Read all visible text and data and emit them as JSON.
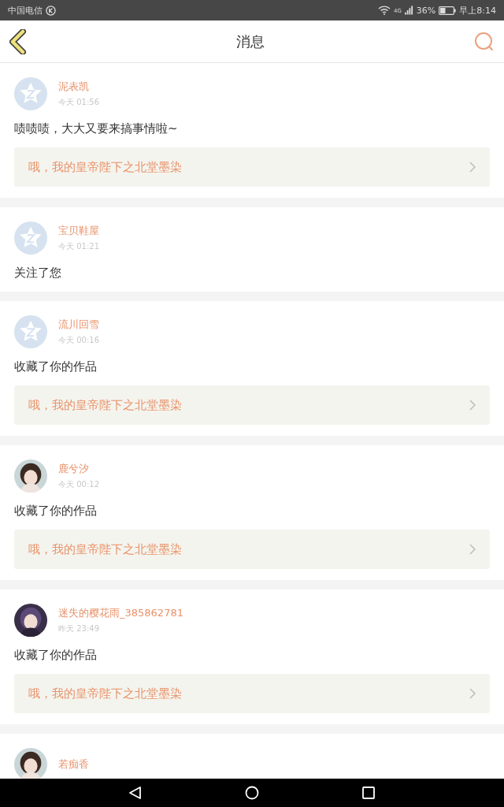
{
  "status_bar": {
    "carrier": "中国电信",
    "network": "4G",
    "battery": "36%",
    "time": "早上8:14"
  },
  "header": {
    "title": "消息"
  },
  "messages": [
    {
      "kind": "default",
      "name": "泥表凯",
      "time": "今天 01:56",
      "text": "啧啧啧，大大又要来搞事情啦~",
      "quote": "哦，我的皇帝陛下之北堂墨染"
    },
    {
      "kind": "default",
      "name": "宝贝鞋屋",
      "time": "今天 01:21",
      "text": "关注了您"
    },
    {
      "kind": "default",
      "name": "流川回雪",
      "time": "今天 00:16",
      "text": "收藏了你的作品",
      "quote": "哦，我的皇帝陛下之北堂墨染"
    },
    {
      "kind": "picture",
      "name": "鹿兮汐",
      "time": "今天 00:12",
      "text": "收藏了你的作品",
      "quote": "哦，我的皇帝陛下之北堂墨染"
    },
    {
      "kind": "picture",
      "name": "迷失的樱花雨_385862781",
      "time": "昨天 23:49",
      "text": "收藏了你的作品",
      "quote": "哦，我的皇帝陛下之北堂墨染"
    },
    {
      "kind": "picture",
      "name": "若痴香"
    }
  ]
}
